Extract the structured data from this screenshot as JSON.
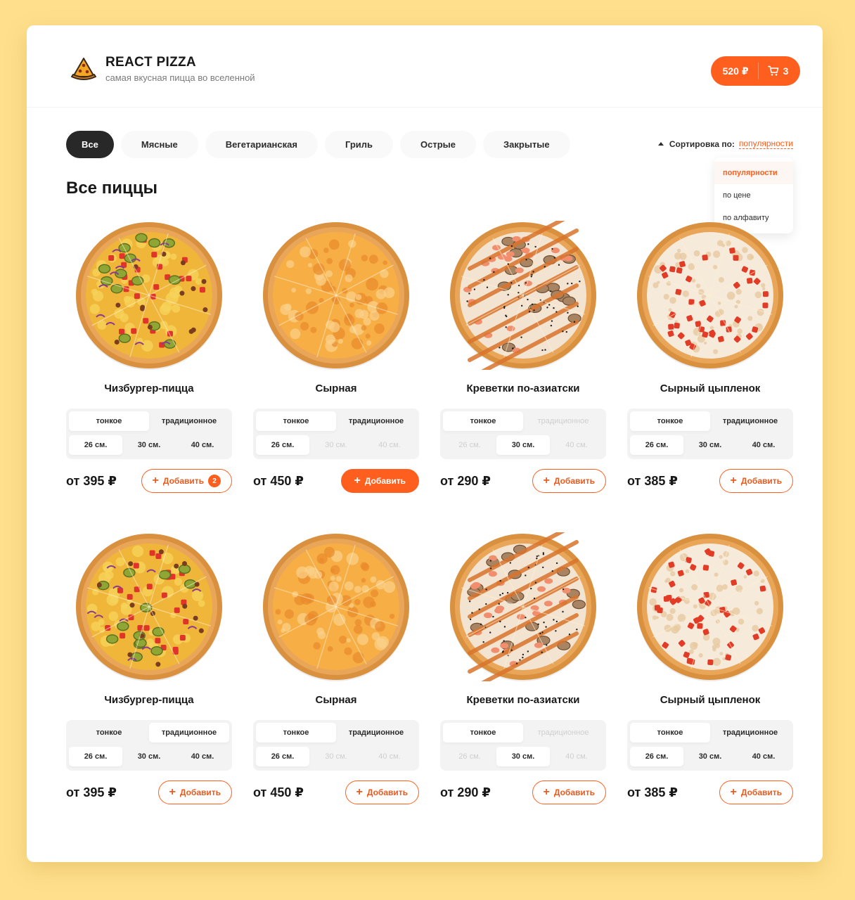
{
  "header": {
    "title": "REACT PIZZA",
    "subtitle": "самая вкусная пицца во вселенной",
    "cart_total": "520 ₽",
    "cart_count": "3"
  },
  "categories": [
    "Все",
    "Мясные",
    "Вегетарианская",
    "Гриль",
    "Острые",
    "Закрытые"
  ],
  "active_category": "Все",
  "sort": {
    "label": "Сортировка по:",
    "value": "популярности",
    "options": [
      "популярности",
      "по цене",
      "по алфавиту"
    ]
  },
  "content_title": "Все пиццы",
  "dough_types": [
    "тонкое",
    "традиционное"
  ],
  "sizes": [
    "26 см.",
    "30 см.",
    "40 см."
  ],
  "add_label": "Добавить",
  "pizzas": [
    {
      "name": "Чизбургер-пицца",
      "price": "от 395 ₽",
      "kind": "cheeseburger",
      "type_sel": 0,
      "type_dis": [],
      "size_sel": 0,
      "size_dis": [],
      "count": "2",
      "filled": false
    },
    {
      "name": "Сырная",
      "price": "от 450 ₽",
      "kind": "cheese",
      "type_sel": 0,
      "type_dis": [],
      "size_sel": 0,
      "size_dis": [
        1,
        2
      ],
      "count": "",
      "filled": true
    },
    {
      "name": "Креветки по-азиатски",
      "price": "от 290 ₽",
      "kind": "shrimp",
      "type_sel": 0,
      "type_dis": [
        1
      ],
      "size_sel": 1,
      "size_dis": [
        0,
        2
      ],
      "count": "",
      "filled": false
    },
    {
      "name": "Сырный цыпленок",
      "price": "от 385 ₽",
      "kind": "chicken",
      "type_sel": 0,
      "type_dis": [],
      "size_sel": 0,
      "size_dis": [],
      "count": "",
      "filled": false
    },
    {
      "name": "Чизбургер-пицца",
      "price": "от 395 ₽",
      "kind": "cheeseburger",
      "type_sel": 1,
      "type_dis": [],
      "size_sel": 0,
      "size_dis": [],
      "count": "",
      "filled": false
    },
    {
      "name": "Сырная",
      "price": "от 450 ₽",
      "kind": "cheese",
      "type_sel": 0,
      "type_dis": [],
      "size_sel": 0,
      "size_dis": [
        1,
        2
      ],
      "count": "",
      "filled": false
    },
    {
      "name": "Креветки по-азиатски",
      "price": "от 290 ₽",
      "kind": "shrimp",
      "type_sel": 0,
      "type_dis": [
        1
      ],
      "size_sel": 1,
      "size_dis": [
        0,
        2
      ],
      "count": "",
      "filled": false
    },
    {
      "name": "Сырный цыпленок",
      "price": "от 385 ₽",
      "kind": "chicken",
      "type_sel": 0,
      "type_dis": [],
      "size_sel": 0,
      "size_dis": [],
      "count": "",
      "filled": false
    }
  ],
  "colors": {
    "accent": "#FE5F1E",
    "background": "#FFDF8C",
    "dark": "#282828"
  }
}
